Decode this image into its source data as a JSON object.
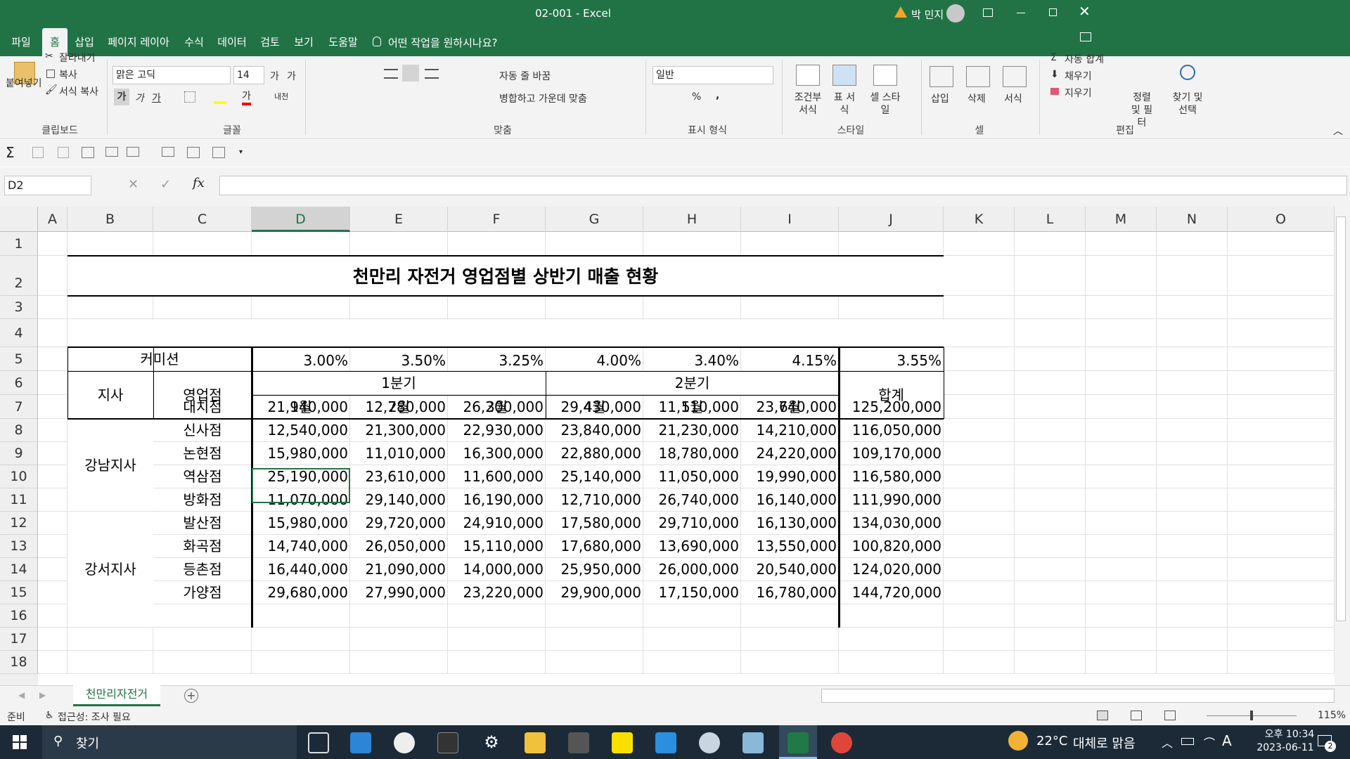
{
  "window": {
    "title": "02-001  -  Excel",
    "user": "박 민지"
  },
  "tabs": [
    "파일",
    "홈",
    "삽입",
    "페이지 레이아웃",
    "수식",
    "데이터",
    "검토",
    "보기",
    "도움말"
  ],
  "tell_me": "어떤 작업을 원하시나요?",
  "ribbon": {
    "clipboard": {
      "paste": "붙여넣기",
      "cut": "잘라내기",
      "copy": "복사",
      "format_painter": "서식 복사",
      "group": "클립보드"
    },
    "font": {
      "name": "맑은 고딕",
      "size": "14",
      "bold": "가",
      "italic": "가",
      "underline": "가",
      "grow": "가",
      "shrink": "가",
      "phonetic": "내천",
      "font_color": "가",
      "group": "글꼴"
    },
    "alignment": {
      "wrap": "자동 줄 바꿈",
      "merge": "병합하고 가운데 맞춤",
      "group": "맞춤"
    },
    "number": {
      "format": "일반",
      "percent": "%",
      "comma": ",",
      "group": "표시 형식"
    },
    "styles": {
      "conditional": "조건부 서식",
      "table": "표 서식",
      "cell": "셀 스타일",
      "group": "스타일"
    },
    "cells": {
      "insert": "삽입",
      "delete": "삭제",
      "format": "서식",
      "group": "셀"
    },
    "editing": {
      "autosum": "자동 합계",
      "fill": "채우기",
      "clear": "지우기",
      "sort": "정렬 및 필터",
      "find": "찾기 및 선택",
      "group": "편집"
    }
  },
  "formula_bar": {
    "name_box": "D2",
    "fx": "fx",
    "content": ""
  },
  "columns": [
    "A",
    "B",
    "C",
    "D",
    "E",
    "F",
    "G",
    "H",
    "I",
    "J",
    "K",
    "L",
    "M",
    "N",
    "O"
  ],
  "rows": [
    "1",
    "2",
    "3",
    "4",
    "5",
    "6",
    "7",
    "8",
    "9",
    "10",
    "11",
    "12",
    "13",
    "14",
    "15",
    "16",
    "17",
    "18"
  ],
  "sheet": {
    "title": "천만리 자전거 영업점별 상반기 매출 현황",
    "commission_label": "커미션",
    "commissions": [
      "3.00%",
      "3.50%",
      "3.25%",
      "4.00%",
      "3.40%",
      "4.15%",
      "3.55%"
    ],
    "branch_header": "지사",
    "store_header": "영업점",
    "quarters": [
      "1분기",
      "2분기"
    ],
    "months": [
      "1월",
      "2월",
      "3월",
      "4월",
      "5월",
      "6월"
    ],
    "total_header": "합계",
    "branches": [
      "강남지사",
      "강서지사"
    ],
    "stores": [
      {
        "name": "대치점",
        "values": [
          "21,940,000",
          "12,780,000",
          "26,200,000",
          "29,430,000",
          "11,110,000",
          "23,740,000",
          "125,200,000"
        ]
      },
      {
        "name": "신사점",
        "values": [
          "12,540,000",
          "21,300,000",
          "22,930,000",
          "23,840,000",
          "21,230,000",
          "14,210,000",
          "116,050,000"
        ]
      },
      {
        "name": "논현점",
        "values": [
          "15,980,000",
          "11,010,000",
          "16,300,000",
          "22,880,000",
          "18,780,000",
          "24,220,000",
          "109,170,000"
        ]
      },
      {
        "name": "역삼점",
        "values": [
          "25,190,000",
          "23,610,000",
          "11,600,000",
          "25,140,000",
          "11,050,000",
          "19,990,000",
          "116,580,000"
        ]
      },
      {
        "name": "방화점",
        "values": [
          "11,070,000",
          "29,140,000",
          "16,190,000",
          "12,710,000",
          "26,740,000",
          "16,140,000",
          "111,990,000"
        ]
      },
      {
        "name": "발산점",
        "values": [
          "15,980,000",
          "29,720,000",
          "24,910,000",
          "17,580,000",
          "29,710,000",
          "16,130,000",
          "134,030,000"
        ]
      },
      {
        "name": "화곡점",
        "values": [
          "14,740,000",
          "26,050,000",
          "15,110,000",
          "17,680,000",
          "13,690,000",
          "13,550,000",
          "100,820,000"
        ]
      },
      {
        "name": "등촌점",
        "values": [
          "16,440,000",
          "21,090,000",
          "14,000,000",
          "25,950,000",
          "26,000,000",
          "20,540,000",
          "124,020,000"
        ]
      },
      {
        "name": "가양점",
        "values": [
          "29,680,000",
          "27,990,000",
          "23,220,000",
          "29,900,000",
          "17,150,000",
          "16,780,000",
          "144,720,000"
        ]
      }
    ]
  },
  "sheet_tab": "천만리자전거",
  "status": {
    "ready": "준비",
    "accessibility": "접근성: 조사 필요",
    "zoom": "115%"
  },
  "taskbar": {
    "search": "찾기",
    "weather_temp": "22°C",
    "weather_text": "대체로 맑음",
    "ime": "A",
    "time": "오후 10:34",
    "date": "2023-06-11",
    "notifications": "2"
  },
  "colors": {
    "excel_green": "#217346",
    "taskbar": "#1c2a38"
  }
}
